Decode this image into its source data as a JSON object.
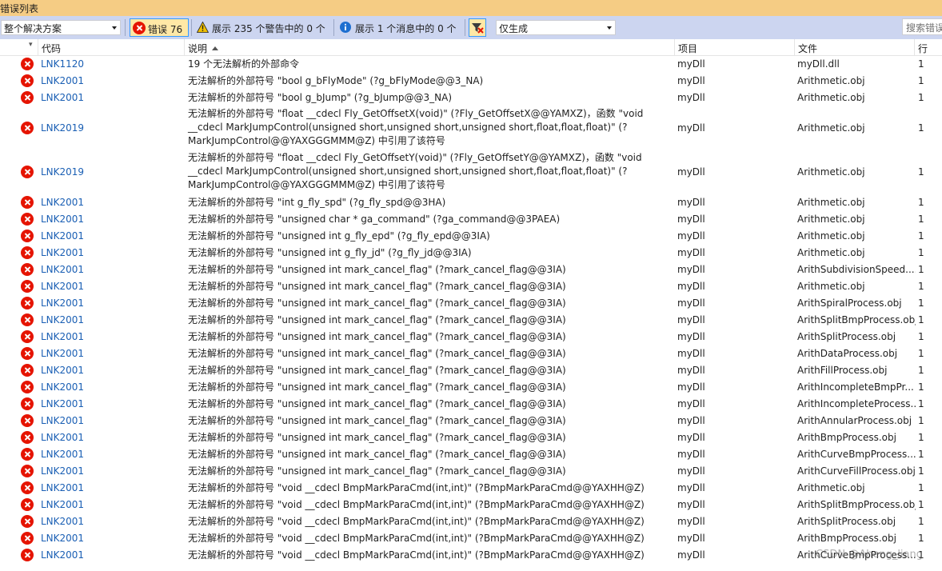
{
  "window": {
    "title": "错误列表"
  },
  "toolbar": {
    "scope": "整个解决方案",
    "errors_label": "错误 76",
    "warnings_label": "展示 235 个警告中的 0 个",
    "messages_label": "展示 1 个消息中的 0 个",
    "build_filter": "仅生成",
    "search_placeholder": "搜索错误"
  },
  "columns": {
    "code": "代码",
    "description": "说明",
    "project": "项目",
    "file": "文件",
    "line": "行"
  },
  "rows": [
    {
      "code": "LNK1120",
      "desc": "19 个无法解析的外部命令",
      "project": "myDll",
      "file": "myDll.dll",
      "line": "1"
    },
    {
      "code": "LNK2001",
      "desc": "无法解析的外部符号 \"bool g_bFlyMode\" (?g_bFlyMode@@3_NA)",
      "project": "myDll",
      "file": "Arithmetic.obj",
      "line": "1"
    },
    {
      "code": "LNK2001",
      "desc": "无法解析的外部符号 \"bool g_bJump\" (?g_bJump@@3_NA)",
      "project": "myDll",
      "file": "Arithmetic.obj",
      "line": "1"
    },
    {
      "code": "LNK2019",
      "desc": "无法解析的外部符号 \"float __cdecl Fly_GetOffsetX(void)\" (?Fly_GetOffsetX@@YAMXZ)，函数 \"void __cdecl MarkJumpControl(unsigned short,unsigned short,unsigned short,float,float,float)\" (?MarkJumpControl@@YAXGGGMMM@Z) 中引用了该符号",
      "project": "myDll",
      "file": "Arithmetic.obj",
      "line": "1"
    },
    {
      "code": "LNK2019",
      "desc": "无法解析的外部符号 \"float __cdecl Fly_GetOffsetY(void)\" (?Fly_GetOffsetY@@YAMXZ)，函数 \"void __cdecl MarkJumpControl(unsigned short,unsigned short,unsigned short,float,float,float)\" (?MarkJumpControl@@YAXGGGMMM@Z) 中引用了该符号",
      "project": "myDll",
      "file": "Arithmetic.obj",
      "line": "1"
    },
    {
      "code": "LNK2001",
      "desc": "无法解析的外部符号 \"int g_fly_spd\" (?g_fly_spd@@3HA)",
      "project": "myDll",
      "file": "Arithmetic.obj",
      "line": "1"
    },
    {
      "code": "LNK2001",
      "desc": "无法解析的外部符号 \"unsigned char * ga_command\" (?ga_command@@3PAEA)",
      "project": "myDll",
      "file": "Arithmetic.obj",
      "line": "1"
    },
    {
      "code": "LNK2001",
      "desc": "无法解析的外部符号 \"unsigned int g_fly_epd\" (?g_fly_epd@@3IA)",
      "project": "myDll",
      "file": "Arithmetic.obj",
      "line": "1"
    },
    {
      "code": "LNK2001",
      "desc": "无法解析的外部符号 \"unsigned int g_fly_jd\" (?g_fly_jd@@3IA)",
      "project": "myDll",
      "file": "Arithmetic.obj",
      "line": "1"
    },
    {
      "code": "LNK2001",
      "desc": "无法解析的外部符号 \"unsigned int mark_cancel_flag\" (?mark_cancel_flag@@3IA)",
      "project": "myDll",
      "file": "ArithSubdivisionSpeed....",
      "line": "1"
    },
    {
      "code": "LNK2001",
      "desc": "无法解析的外部符号 \"unsigned int mark_cancel_flag\" (?mark_cancel_flag@@3IA)",
      "project": "myDll",
      "file": "Arithmetic.obj",
      "line": "1"
    },
    {
      "code": "LNK2001",
      "desc": "无法解析的外部符号 \"unsigned int mark_cancel_flag\" (?mark_cancel_flag@@3IA)",
      "project": "myDll",
      "file": "ArithSpiralProcess.obj",
      "line": "1"
    },
    {
      "code": "LNK2001",
      "desc": "无法解析的外部符号 \"unsigned int mark_cancel_flag\" (?mark_cancel_flag@@3IA)",
      "project": "myDll",
      "file": "ArithSplitBmpProcess.obj",
      "line": "1"
    },
    {
      "code": "LNK2001",
      "desc": "无法解析的外部符号 \"unsigned int mark_cancel_flag\" (?mark_cancel_flag@@3IA)",
      "project": "myDll",
      "file": "ArithSplitProcess.obj",
      "line": "1"
    },
    {
      "code": "LNK2001",
      "desc": "无法解析的外部符号 \"unsigned int mark_cancel_flag\" (?mark_cancel_flag@@3IA)",
      "project": "myDll",
      "file": "ArithDataProcess.obj",
      "line": "1"
    },
    {
      "code": "LNK2001",
      "desc": "无法解析的外部符号 \"unsigned int mark_cancel_flag\" (?mark_cancel_flag@@3IA)",
      "project": "myDll",
      "file": "ArithFillProcess.obj",
      "line": "1"
    },
    {
      "code": "LNK2001",
      "desc": "无法解析的外部符号 \"unsigned int mark_cancel_flag\" (?mark_cancel_flag@@3IA)",
      "project": "myDll",
      "file": "ArithIncompleteBmpPr...",
      "line": "1"
    },
    {
      "code": "LNK2001",
      "desc": "无法解析的外部符号 \"unsigned int mark_cancel_flag\" (?mark_cancel_flag@@3IA)",
      "project": "myDll",
      "file": "ArithIncompleteProcess...",
      "line": "1"
    },
    {
      "code": "LNK2001",
      "desc": "无法解析的外部符号 \"unsigned int mark_cancel_flag\" (?mark_cancel_flag@@3IA)",
      "project": "myDll",
      "file": "ArithAnnularProcess.obj",
      "line": "1"
    },
    {
      "code": "LNK2001",
      "desc": "无法解析的外部符号 \"unsigned int mark_cancel_flag\" (?mark_cancel_flag@@3IA)",
      "project": "myDll",
      "file": "ArithBmpProcess.obj",
      "line": "1"
    },
    {
      "code": "LNK2001",
      "desc": "无法解析的外部符号 \"unsigned int mark_cancel_flag\" (?mark_cancel_flag@@3IA)",
      "project": "myDll",
      "file": "ArithCurveBmpProcess....",
      "line": "1"
    },
    {
      "code": "LNK2001",
      "desc": "无法解析的外部符号 \"unsigned int mark_cancel_flag\" (?mark_cancel_flag@@3IA)",
      "project": "myDll",
      "file": "ArithCurveFillProcess.obj",
      "line": "1"
    },
    {
      "code": "LNK2001",
      "desc": "无法解析的外部符号 \"void __cdecl BmpMarkParaCmd(int,int)\" (?BmpMarkParaCmd@@YAXHH@Z)",
      "project": "myDll",
      "file": "Arithmetic.obj",
      "line": "1"
    },
    {
      "code": "LNK2001",
      "desc": "无法解析的外部符号 \"void __cdecl BmpMarkParaCmd(int,int)\" (?BmpMarkParaCmd@@YAXHH@Z)",
      "project": "myDll",
      "file": "ArithSplitBmpProcess.obj",
      "line": "1"
    },
    {
      "code": "LNK2001",
      "desc": "无法解析的外部符号 \"void __cdecl BmpMarkParaCmd(int,int)\" (?BmpMarkParaCmd@@YAXHH@Z)",
      "project": "myDll",
      "file": "ArithSplitProcess.obj",
      "line": "1"
    },
    {
      "code": "LNK2001",
      "desc": "无法解析的外部符号 \"void __cdecl BmpMarkParaCmd(int,int)\" (?BmpMarkParaCmd@@YAXHH@Z)",
      "project": "myDll",
      "file": "ArithBmpProcess.obj",
      "line": "1"
    },
    {
      "code": "LNK2001",
      "desc": "无法解析的外部符号 \"void __cdecl BmpMarkParaCmd(int,int)\" (?BmpMarkParaCmd@@YAXHH@Z)",
      "project": "myDll",
      "file": "ArithCurveBmpProcess....",
      "line": "1"
    }
  ],
  "watermark": "CSDN @Aheng_liang"
}
